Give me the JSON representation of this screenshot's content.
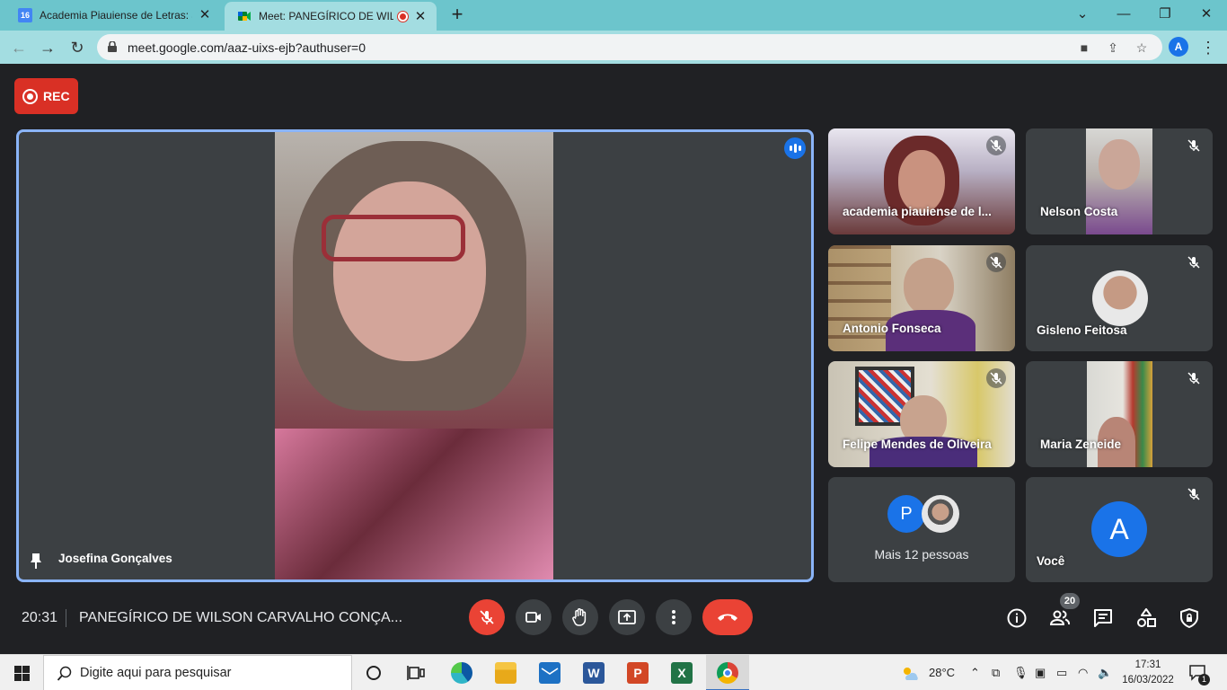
{
  "browser": {
    "tabs": [
      {
        "title": "Academia Piauiense de Letras: ag",
        "favicon_text": "16",
        "active": false
      },
      {
        "title": "Meet: PANEGÍRICO DE WILSC",
        "active": true,
        "recording": true
      }
    ],
    "url": "meet.google.com/aaz-uixs-ejb?authuser=0",
    "profile_initial": "A"
  },
  "meet": {
    "rec_label": "REC",
    "main_speaker": {
      "name": "Josefina Gonçalves",
      "pinned": true,
      "speaking": true
    },
    "participants": [
      {
        "name": "academia piauiense de l...",
        "muted": true,
        "kind": "video"
      },
      {
        "name": "Nelson Costa",
        "muted": true,
        "kind": "video"
      },
      {
        "name": "Antonio Fonseca",
        "muted": true,
        "kind": "video"
      },
      {
        "name": "Gisleno Feitosa",
        "muted": true,
        "kind": "avatar"
      },
      {
        "name": "Felipe Mendes de Oliveira",
        "muted": true,
        "kind": "video"
      },
      {
        "name": "Maria Zeneide",
        "muted": true,
        "kind": "video"
      }
    ],
    "more": {
      "label": "Mais 12 pessoas",
      "avatar_initial": "P"
    },
    "self": {
      "name": "Você",
      "initial": "A",
      "muted": true
    }
  },
  "bottom_bar": {
    "time": "20:31",
    "meeting_title": "PANEGÍRICO DE WILSON CARVALHO CONÇA...",
    "participant_count": "20",
    "controls": [
      "mic-off",
      "camera",
      "raise-hand",
      "present",
      "more",
      "leave-call"
    ],
    "right_controls": [
      "info",
      "people",
      "chat",
      "activities",
      "host-controls"
    ]
  },
  "taskbar": {
    "search_placeholder": "Digite aqui para pesquisar",
    "weather": "28°C",
    "time": "17:31",
    "date": "16/03/2022",
    "notification_count": "1"
  },
  "colors": {
    "tab_strip": "#6cc5cc",
    "address_bar": "#a3dde1",
    "meet_bg": "#202124",
    "tile_bg": "#3c4043",
    "accent_blue": "#1a73e8",
    "active_border": "#8ab4f8",
    "danger_red": "#ea4335"
  }
}
